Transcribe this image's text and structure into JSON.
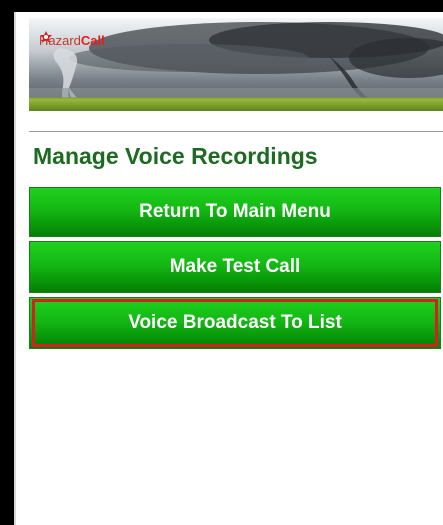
{
  "header": {
    "logo_hazard": "Hazard",
    "logo_call": "Call",
    "logo_icon": "hazard-logo-icon",
    "banner_image": "tornado-banner"
  },
  "page": {
    "title": "Manage Voice Recordings"
  },
  "menu": {
    "items": [
      {
        "label": "Return To Main Menu",
        "highlighted": false
      },
      {
        "label": "Make Test Call",
        "highlighted": false
      },
      {
        "label": "Voice Broadcast To List",
        "highlighted": true
      }
    ]
  },
  "colors": {
    "title": "#1d6a21",
    "button_green": "#14b814",
    "highlight_red": "#d62020",
    "logo_red": "#e01e1e"
  }
}
